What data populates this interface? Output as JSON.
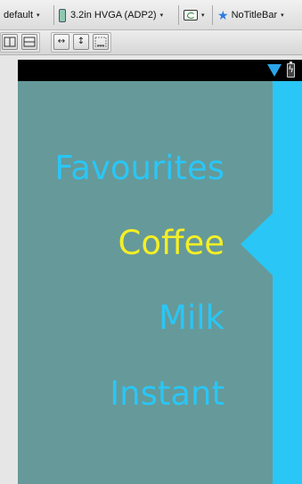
{
  "toolbar": {
    "config": "default",
    "device": "3.2in HVGA (ADP2)",
    "theme": "NoTitleBar",
    "arrow": "▾"
  },
  "toolbar2": {
    "icons": [
      "split-vertical-icon",
      "split-horizontal-icon",
      "expand-horizontal-icon",
      "expand-vertical-icon",
      "layout-icon"
    ],
    "expand_h": "↔",
    "expand_v": "↕"
  },
  "statusbar": {
    "battery_glyph": "ϟ"
  },
  "menu": {
    "items": [
      "Favourites",
      "Coffee",
      "Milk",
      "Instant"
    ],
    "selected_index": 1
  },
  "colors": {
    "menu_background": "#669999",
    "accent": "#2ac6f6",
    "selected_text": "#f4ef26",
    "statusbar": "#000000"
  }
}
